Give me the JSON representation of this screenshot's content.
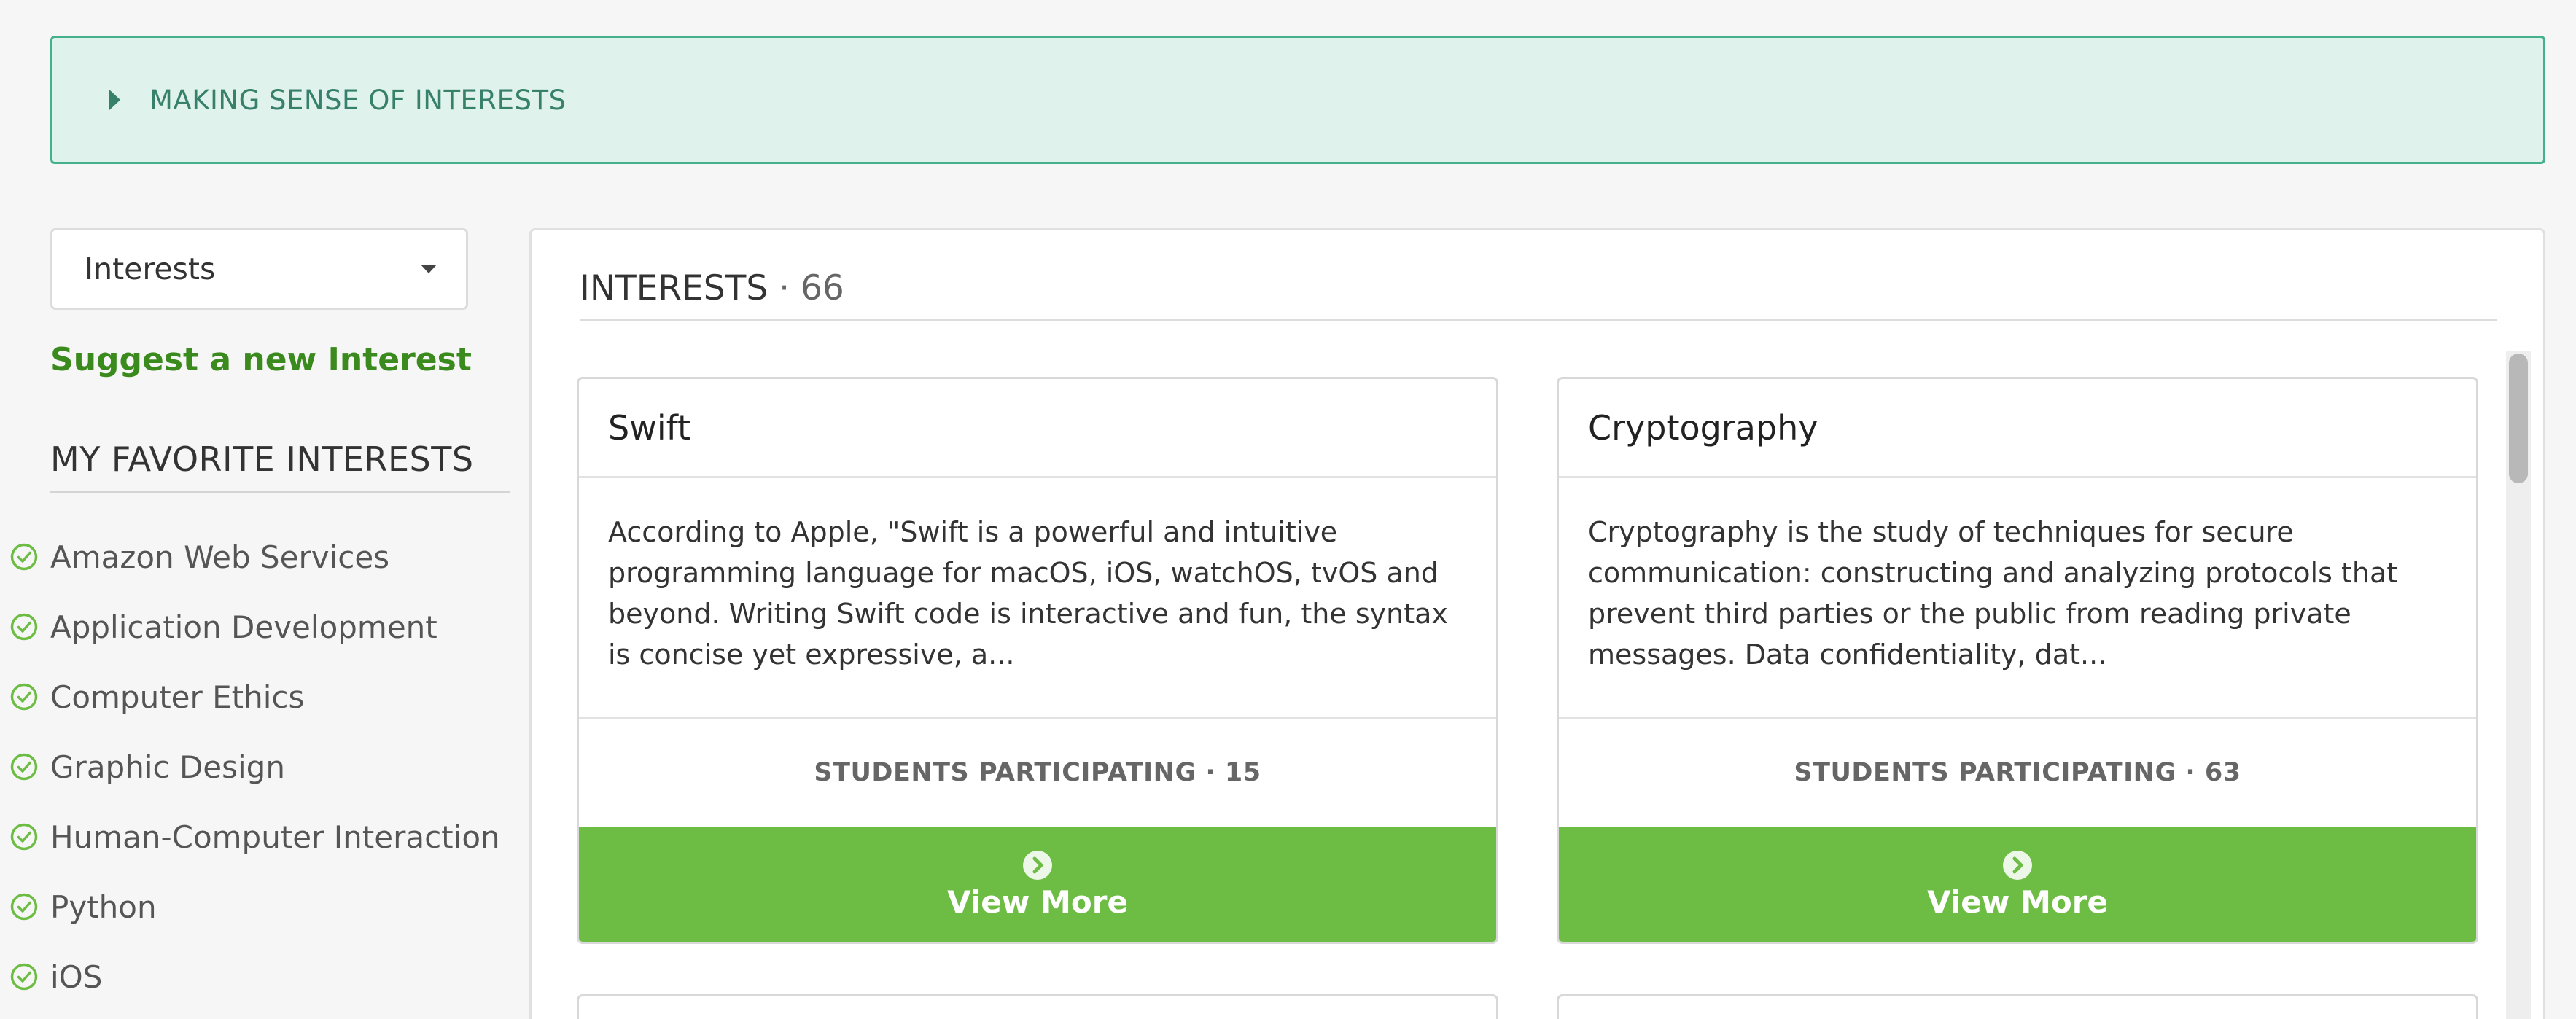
{
  "banner": {
    "title": "MAKING SENSE OF INTERESTS",
    "caret_icon": "caret-right-icon"
  },
  "filter": {
    "selected": "Interests",
    "caret_icon": "caret-down-icon"
  },
  "suggest_link": "Suggest a new Interest",
  "favorites": {
    "heading": "MY FAVORITE INTERESTS",
    "check_icon": "check-circle-icon",
    "items": [
      {
        "label": "Amazon Web Services"
      },
      {
        "label": "Application Development"
      },
      {
        "label": "Computer Ethics"
      },
      {
        "label": "Graphic Design"
      },
      {
        "label": "Human-Computer Interaction"
      },
      {
        "label": "Python"
      },
      {
        "label": "iOS"
      }
    ]
  },
  "main": {
    "title": "INTERESTS",
    "count_text": "· 66",
    "cards": [
      {
        "title": "Swift",
        "description": " According to Apple, \"Swift is a powerful and intuitive programming language for macOS, iOS, watchOS, tvOS and beyond. Writing Swift code is interactive and fun, the syntax is concise yet expressive, a...",
        "students": "STUDENTS PARTICIPATING · 15",
        "button_label": "View More",
        "button_icon": "chevron-circle-right-icon"
      },
      {
        "title": "Cryptography",
        "description": " Cryptography is the study of techniques for secure communication: constructing and analyzing protocols that prevent third parties or the public from reading private messages. Data confidentiality, dat...",
        "students": "STUDENTS PARTICIPATING · 63",
        "button_label": "View More",
        "button_icon": "chevron-circle-right-icon"
      }
    ]
  },
  "colors": {
    "banner_bg": "#e0f2ec",
    "banner_border": "#45b08c",
    "banner_text": "#37806a",
    "link_green": "#3b8a1d",
    "button_green": "#6dbd45",
    "check_green": "#6dbd45"
  }
}
